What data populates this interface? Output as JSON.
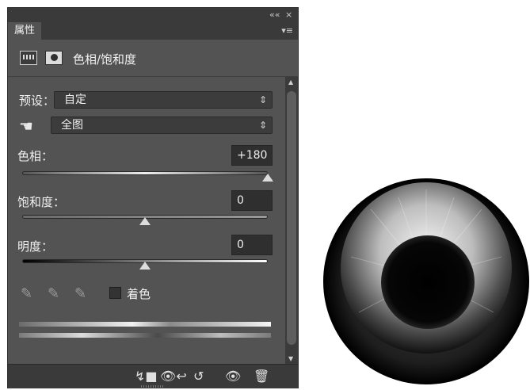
{
  "window": {
    "collapse_glyph": "««",
    "close_glyph": "×",
    "tab_label": "属性",
    "menu_glyph": "▾≡"
  },
  "header": {
    "title": "色相/饱和度",
    "icons": [
      "adjustment-layer-icon",
      "layer-mask-icon"
    ]
  },
  "preset": {
    "label": "预设：",
    "value": "自定"
  },
  "channel": {
    "value": "全图"
  },
  "hue": {
    "label": "色相：",
    "value": "+180",
    "slider_fraction": 1.0
  },
  "saturation": {
    "label": "饱和度：",
    "value": "0",
    "slider_fraction": 0.5
  },
  "lightness": {
    "label": "明度：",
    "value": "0",
    "slider_fraction": 0.5
  },
  "colorize": {
    "label": "着色",
    "checked": false
  },
  "glyphs": {
    "select_arrow": "⇕",
    "hand": "☚",
    "eyedropper": "✎",
    "scroll_up": "▲",
    "scroll_down": "▼",
    "clip": "↯■",
    "view_prev": "👁↩",
    "reset": "↺",
    "eye": "👁",
    "trash": "🗑"
  },
  "colors": {
    "panel_bg": "#535353",
    "panel_dark": "#3a3a3a",
    "text": "#f0f0f0"
  }
}
